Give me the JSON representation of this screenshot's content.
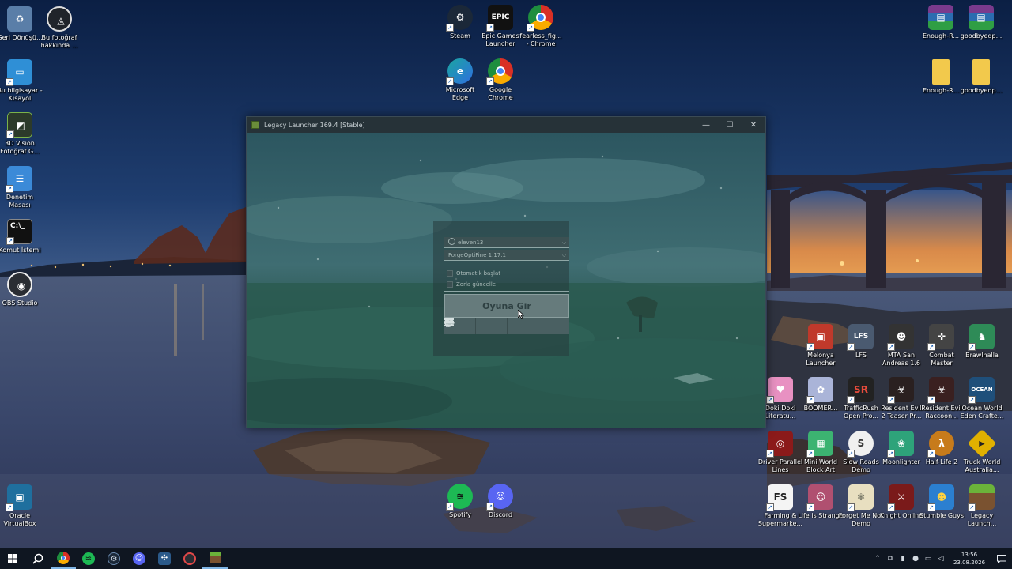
{
  "desktop": {
    "icons": [
      {
        "label": "Geri Dönüşü...",
        "icon": "recycle-bin-icon",
        "color": "#5a7ea8"
      },
      {
        "label": "Bu fotoğraf hakkında ...",
        "icon": "info-camera-icon",
        "color": "#20242a"
      },
      {
        "label": "Bu bilgisayar - Kısayol",
        "icon": "computer-icon",
        "color": "#2f8fd6"
      },
      {
        "label": "3D Vision Fotoğraf G...",
        "icon": "3d-vision-icon",
        "color": "#2c3a2a"
      },
      {
        "label": "Denetim Masası",
        "icon": "control-panel-icon",
        "color": "#3b8ad8"
      },
      {
        "label": "Komut İstemi",
        "icon": "command-prompt-icon",
        "color": "#111111"
      },
      {
        "label": "OBS Studio",
        "icon": "obs-icon",
        "color": "#2a2d33"
      },
      {
        "label": "Oracle VirtualBox",
        "icon": "virtualbox-icon",
        "color": "#1f6f9e"
      },
      {
        "label": "Steam",
        "icon": "steam-icon",
        "color": "#1b2838"
      },
      {
        "label": "Epic Games Launcher",
        "icon": "epic-games-icon",
        "color": "#111111"
      },
      {
        "label": "fearless_fig... - Chrome",
        "icon": "chrome-profile-icon",
        "color": "#d93025"
      },
      {
        "label": "Microsoft Edge",
        "icon": "edge-icon",
        "color": "#1aa5a1"
      },
      {
        "label": "Google Chrome",
        "icon": "chrome-icon",
        "color": "#d93025"
      },
      {
        "label": "Spotify",
        "icon": "spotify-icon",
        "color": "#1db954"
      },
      {
        "label": "Discord",
        "icon": "discord-icon",
        "color": "#5865f2"
      },
      {
        "label": "Enough-R...",
        "icon": "winrar-archive-icon",
        "color": "#7a3a8c"
      },
      {
        "label": "goodbyedp...",
        "icon": "winrar-archive-icon",
        "color": "#7a3a8c"
      },
      {
        "label": "Enough-R...",
        "icon": "folder-icon",
        "color": "#f2c94c"
      },
      {
        "label": "goodbyedp...",
        "icon": "folder-icon",
        "color": "#f2c94c"
      },
      {
        "label": "Melonya Launcher",
        "icon": "melonya-icon",
        "color": "#c0392b"
      },
      {
        "label": "LFS",
        "icon": "lfs-icon",
        "color": "#4a5a70"
      },
      {
        "label": "MTA San Andreas 1.6",
        "icon": "mta-icon",
        "color": "#333333"
      },
      {
        "label": "Combat Master",
        "icon": "combat-master-icon",
        "color": "#444444"
      },
      {
        "label": "Brawlhalla",
        "icon": "brawlhalla-icon",
        "color": "#2e8b57"
      },
      {
        "label": "Doki Doki Literatu...",
        "icon": "doki-doki-icon",
        "color": "#e891c2"
      },
      {
        "label": "BOOMER...",
        "icon": "boomer-icon",
        "color": "#aab4d8"
      },
      {
        "label": "TrafficRush Open Pro...",
        "icon": "trafficrush-icon",
        "color": "#222222"
      },
      {
        "label": "Resident Evil 2 Teaser Pr...",
        "icon": "resident-evil-icon",
        "color": "#2a2020"
      },
      {
        "label": "Resident Evil Raccoon...",
        "icon": "resident-evil-raccoon-icon",
        "color": "#3a2020"
      },
      {
        "label": "Ocean World Eden Crafte...",
        "icon": "ocean-world-icon",
        "color": "#1f4f7a"
      },
      {
        "label": "Driver Parallel Lines",
        "icon": "driver-icon",
        "color": "#8b1a1a"
      },
      {
        "label": "Mini World Block Art",
        "icon": "mini-world-icon",
        "color": "#3cb371"
      },
      {
        "label": "Slow Roads Demo",
        "icon": "slow-roads-icon",
        "color": "#f0f0f0"
      },
      {
        "label": "Moonlighter",
        "icon": "moonlighter-icon",
        "color": "#2ea37a"
      },
      {
        "label": "Half-Life 2",
        "icon": "half-life-icon",
        "color": "#c77b1b"
      },
      {
        "label": "Truck World Australia...",
        "icon": "truck-world-icon",
        "color": "#e0b000"
      },
      {
        "label": "Farming & Supermarke...",
        "icon": "farming-icon",
        "color": "#f4f4f4"
      },
      {
        "label": "Life is Strange",
        "icon": "life-is-strange-icon",
        "color": "#b05070"
      },
      {
        "label": "Forget Me Not Demo",
        "icon": "forget-me-not-icon",
        "color": "#e8dfc0"
      },
      {
        "label": "Knight Online",
        "icon": "knight-online-icon",
        "color": "#7a1a1a"
      },
      {
        "label": "Stumble Guys",
        "icon": "stumble-guys-icon",
        "color": "#2b7fd0"
      },
      {
        "label": "Legacy Launch...",
        "icon": "legacy-launcher-icon",
        "color": "#5a8a2a"
      }
    ]
  },
  "launcher": {
    "title": "Legacy Launcher 169.4 [Stable]",
    "minimize": "—",
    "maximize": "☐",
    "close": "✕",
    "account": "eleven13",
    "version": "ForgeOptiFine 1.17.1",
    "chevron": "⌵",
    "auto_start": "Otomatik başlat",
    "force_update": "Zorla güncelle",
    "play_button": "Oyuna Gir"
  },
  "taskbar": {
    "apps": [
      "start-icon",
      "search-icon",
      "chrome-icon",
      "spotify-icon",
      "steam-icon",
      "discord-icon",
      "network-tool-icon",
      "obs-record-icon",
      "legacy-launcher-icon"
    ],
    "tray_chevron": "⌃",
    "time": "13:56",
    "date": "23.08.2026"
  }
}
